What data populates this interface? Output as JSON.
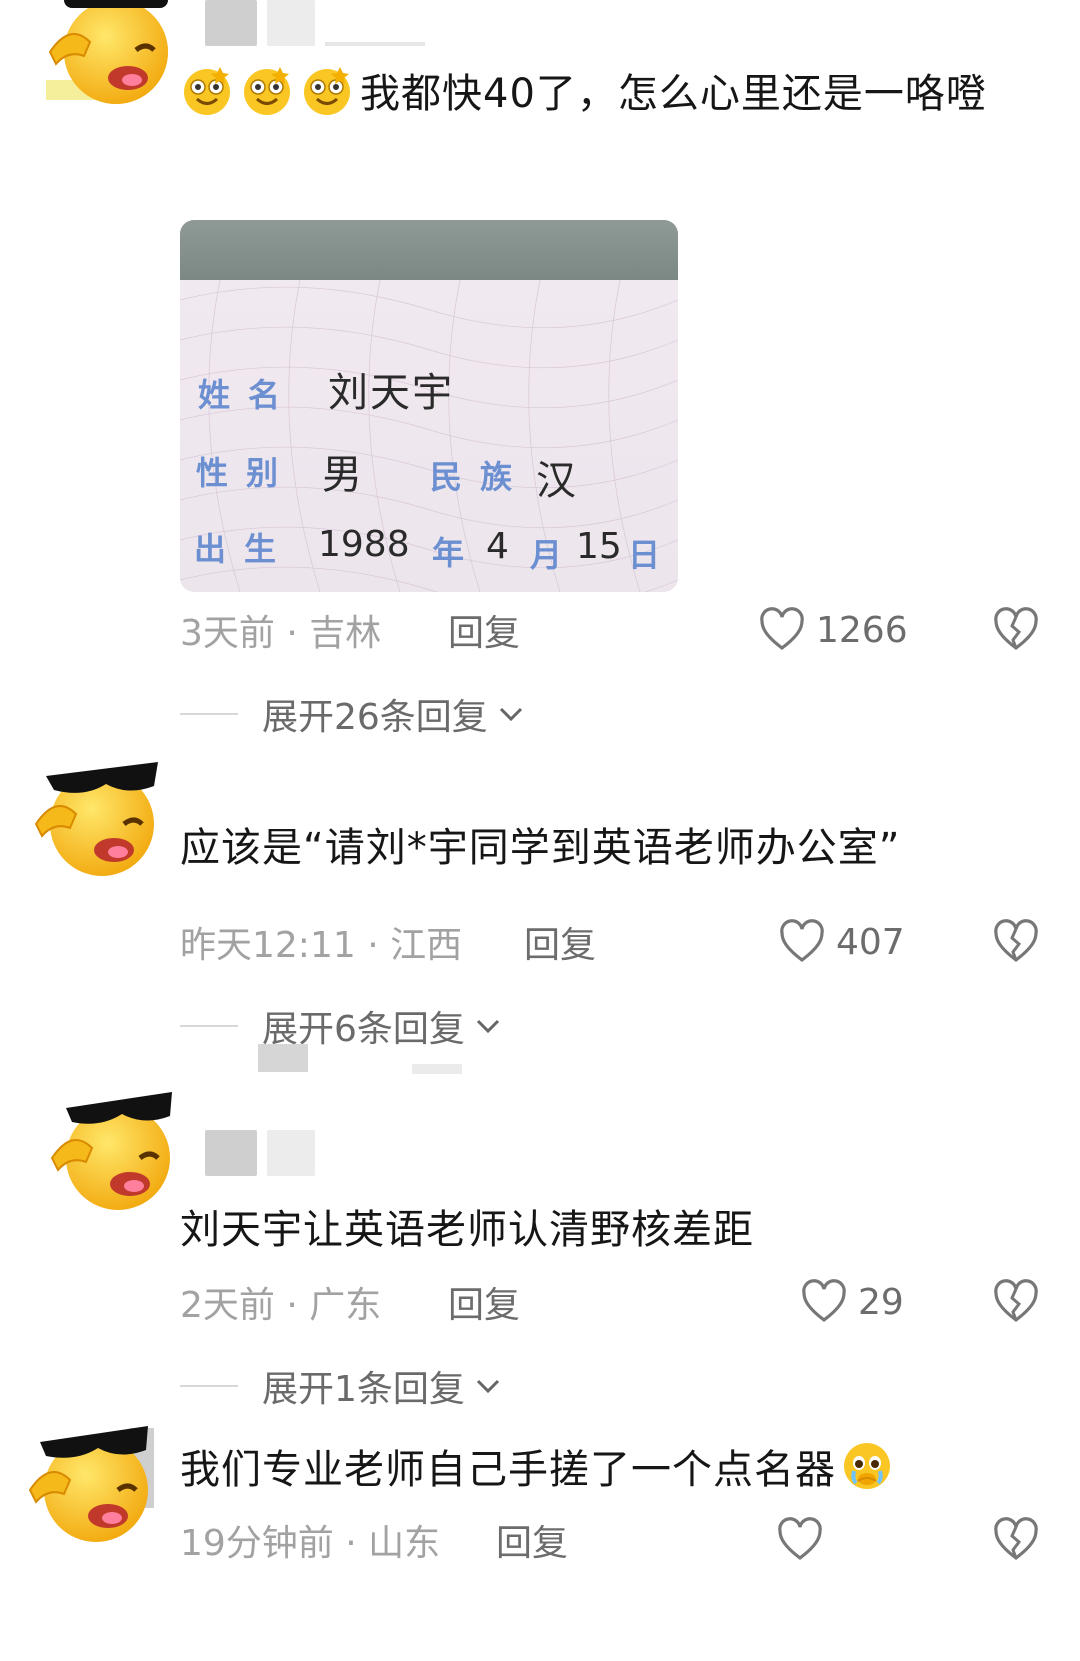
{
  "comments": [
    {
      "text_prefix_emojis": [
        "grin-stars-emoji",
        "grin-stars-emoji",
        "grin-stars-emoji"
      ],
      "text": "我都快40了，怎么心里还是一咯噔",
      "photo": {
        "rows": [
          {
            "label": "姓名",
            "value": "刘天宇"
          },
          {
            "label": "性别",
            "value": "男",
            "label2": "民族",
            "value2": "汉"
          },
          {
            "label": "出生",
            "year": "1988",
            "year_unit": "年",
            "month": "4",
            "month_unit": "月",
            "day": "15",
            "day_unit": "日"
          }
        ]
      },
      "time_location": "3天前 · 吉林",
      "reply_label": "回复",
      "likes": "1266",
      "expand_label": "展开26条回复"
    },
    {
      "text": "应该是“请刘*宇同学到英语老师办公室”",
      "time_location": "昨天12:11 · 江西",
      "reply_label": "回复",
      "likes": "407",
      "expand_label": "展开6条回复"
    },
    {
      "text": "刘天宇让英语老师认清野核差距",
      "time_location": "2天前 · 广东",
      "reply_label": "回复",
      "likes": "29",
      "expand_label": "展开1条回复"
    },
    {
      "text": "我们专业老师自己手搓了一个点名器",
      "text_suffix_emoji": "pleading-tears-emoji",
      "time_location": "19分钟前 · 山东",
      "reply_label": "回复"
    }
  ],
  "colors": {
    "text": "#161616",
    "meta": "#a2a2a2",
    "action": "#6c6c6c",
    "id_label": "#6b8fd1"
  }
}
